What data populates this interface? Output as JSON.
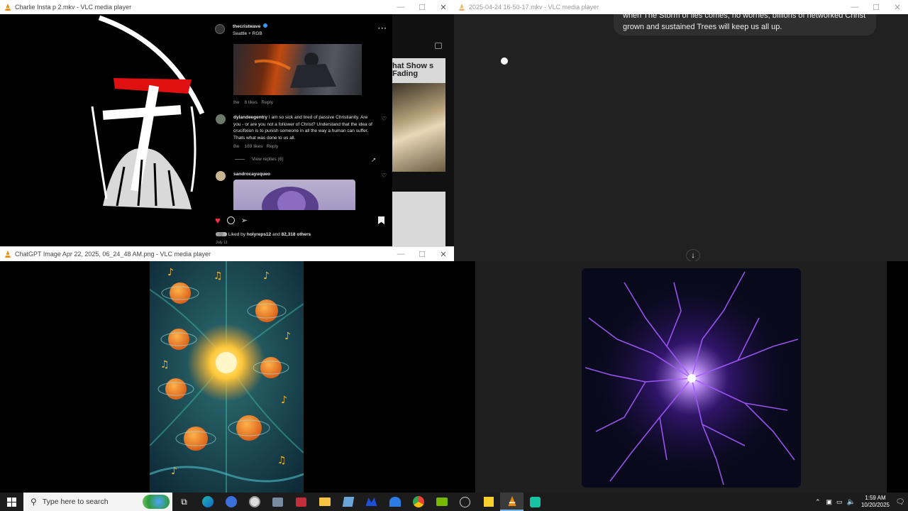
{
  "windows": {
    "w1": {
      "title": "Charlie Insta p 2.mkv - VLC media player",
      "instagram": {
        "poster": {
          "username": "thecristwave",
          "subtitle": "Seattle + RGB"
        },
        "reply1_meta": {
          "age": "8w",
          "likes": "8 likes",
          "reply": "Reply"
        },
        "comment2": {
          "username": "dylandeegentry",
          "text": "I am so sick and tired of passive Christianity. Are you - or are you not a follower of Christ? Understand that the idea of crucifixion is to punish someone in all the way a human can suffer. Thats what was done to us all.",
          "age": "8w",
          "likes": "169 likes",
          "reply": "Reply"
        },
        "view_replies": "View replies (6)",
        "comment3": {
          "username": "sandrocayuqueo"
        },
        "liked_by_prefix": "Liked by",
        "liked_by_user": "holyreps12",
        "liked_by_and": "and",
        "liked_by_count": "82,318 others",
        "date": "July 11",
        "side_headline": "hat Show s Fading"
      }
    },
    "w2": {
      "title": "2025-04-24 16-50-17.mkv - VLC media player",
      "chat_bubble": "when The Storm of lies comes, no worries, billions of networked Christ grown and sustained Trees will keep us all up."
    },
    "w3": {
      "title": "ChatGPT Image Apr 22, 2025, 06_24_48 AM.png - VLC media player"
    }
  },
  "taskbar": {
    "search_placeholder": "Type here to search",
    "time": "1:59 AM",
    "date": "10/20/2025"
  },
  "icons": [
    "windows-start-icon",
    "search-icon",
    "task-view-icon",
    "edge-icon",
    "file-explorer-icon",
    "vlc-icon",
    "notification-icon"
  ],
  "colors": {
    "vlc_orange": "#f08a00",
    "taskbar": "#1c1c1c",
    "chat_bg": "#212121",
    "like_red": "#ff3040",
    "electric_purple": "#8a2be2"
  }
}
